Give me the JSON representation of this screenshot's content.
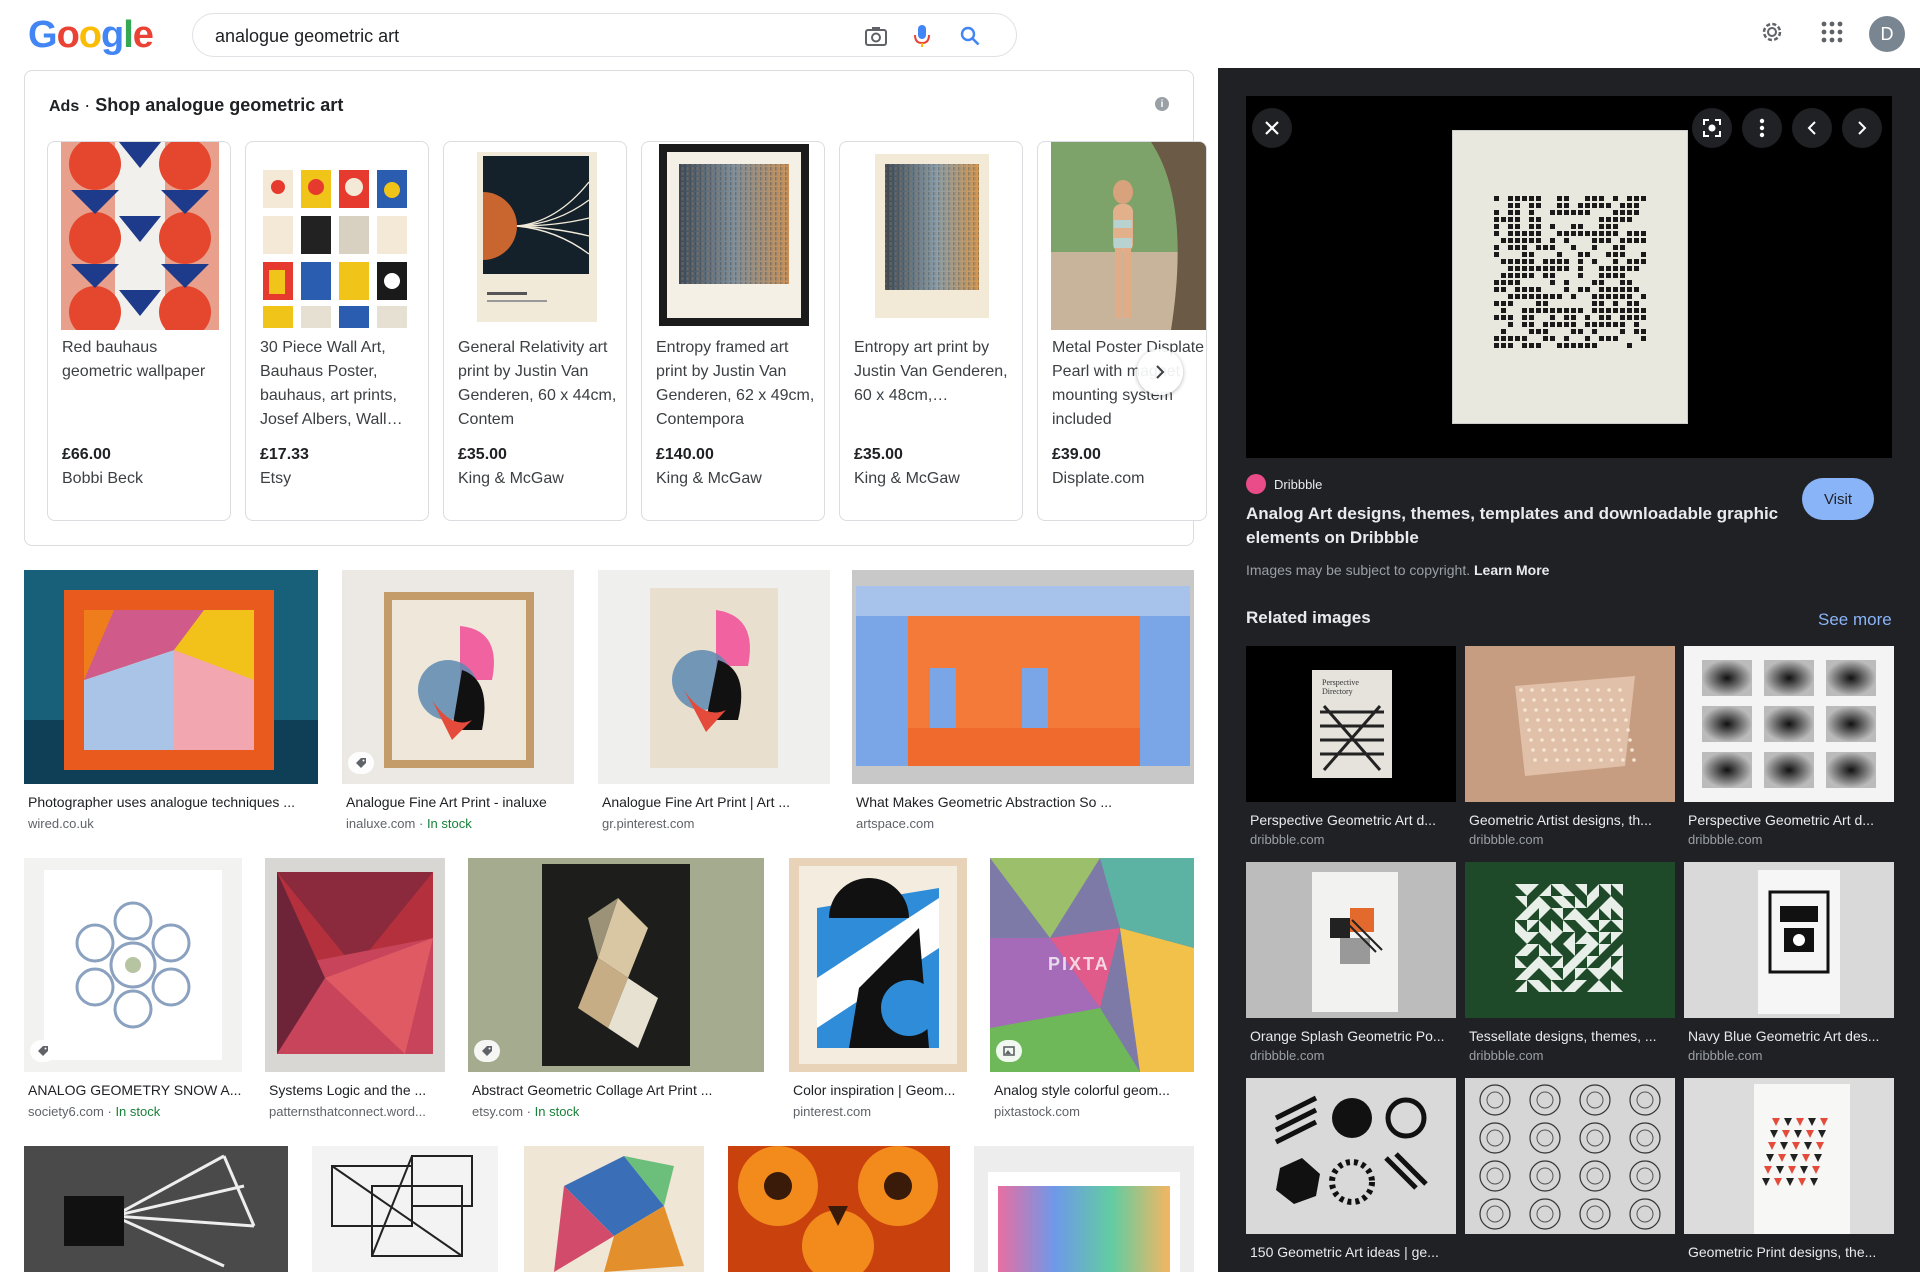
{
  "logo": {
    "text": "Google",
    "colors": [
      "#4285f4",
      "#ea4335",
      "#fbbc05",
      "#4285f4",
      "#34a853",
      "#ea4335"
    ]
  },
  "search": {
    "query": "analogue geometric art"
  },
  "header": {
    "avatar_letter": "D"
  },
  "ads": {
    "tag": "Ads",
    "separator": "·",
    "heading": "Shop analogue geometric art",
    "info_glyph": "i",
    "items": [
      {
        "title": "Red bauhaus geometric wallpaper",
        "price": "£66.00",
        "merchant": "Bobbi Beck"
      },
      {
        "title": "30 Piece Wall Art, Bauhaus Poster, bauhaus, art prints, Josef Albers, Wall…",
        "price": "£17.33",
        "merchant": "Etsy"
      },
      {
        "title": "General Relativity art print by Justin Van Genderen, 60 x 44cm, Contem",
        "price": "£35.00",
        "merchant": "King & McGaw"
      },
      {
        "title": "Entropy framed art print by Justin Van Genderen, 62 x 49cm, Contempora",
        "price": "£140.00",
        "merchant": "King & McGaw"
      },
      {
        "title": "Entropy art print by Justin Van Genderen, 60 x 48cm,…",
        "price": "£35.00",
        "merchant": "King & McGaw"
      },
      {
        "title": "Metal Poster Displate Pearl with magnet mounting system included",
        "price": "£39.00",
        "merchant": "Displate.com"
      }
    ]
  },
  "results": {
    "row1": [
      {
        "title": "Photographer uses analogue techniques ...",
        "source": "wired.co.uk",
        "stock": ""
      },
      {
        "title": "Analogue Fine Art Print - inaluxe",
        "source": "inaluxe.com",
        "stock": "In stock"
      },
      {
        "title": "Analogue Fine Art Print | Art ...",
        "source": "gr.pinterest.com",
        "stock": ""
      },
      {
        "title": "What Makes Geometric Abstraction So ...",
        "source": "artspace.com",
        "stock": ""
      }
    ],
    "row2": [
      {
        "title": "ANALOG GEOMETRY SNOW A...",
        "source": "society6.com",
        "stock": "In stock"
      },
      {
        "title": "Systems Logic and the ...",
        "source": "patternsthatconnect.word...",
        "stock": ""
      },
      {
        "title": "Abstract Geometric Collage Art Print ...",
        "source": "etsy.com",
        "stock": "In stock"
      },
      {
        "title": "Color inspiration | Geom...",
        "source": "pinterest.com",
        "stock": ""
      },
      {
        "title": "Analog style colorful geom...",
        "source": "pixtastock.com",
        "stock": ""
      }
    ],
    "stock_separator": " · ",
    "watermark": "PIXTA"
  },
  "side_panel": {
    "source_name": "Dribbble",
    "title": "Analog Art designs, themes, templates and downloadable graphic elements on Dribbble",
    "visit_label": "Visit",
    "copyright_text": "Images may be subject to copyright.",
    "learn_more": "Learn More",
    "related_label": "Related images",
    "see_more": "See more",
    "related": [
      {
        "title": "Perspective Geometric Art d...",
        "source": "dribbble.com",
        "book_text": "Perspective Directory"
      },
      {
        "title": "Geometric Artist designs, th...",
        "source": "dribbble.com"
      },
      {
        "title": "Perspective Geometric Art d...",
        "source": "dribbble.com"
      },
      {
        "title": "Orange Splash Geometric Po...",
        "source": "dribbble.com"
      },
      {
        "title": "Tessellate designs, themes, ...",
        "source": "dribbble.com"
      },
      {
        "title": "Navy Blue Geometric Art des...",
        "source": "dribbble.com"
      },
      {
        "title": "150 Geometric Art ideas | ge...",
        "source": ""
      },
      {
        "title": "",
        "source": ""
      },
      {
        "title": "Geometric Print designs, the...",
        "source": ""
      }
    ]
  }
}
